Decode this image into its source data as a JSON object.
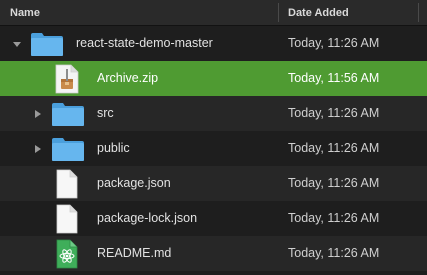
{
  "header": {
    "name_label": "Name",
    "date_label": "Date Added"
  },
  "rows": [
    {
      "name": "react-state-demo-master",
      "date": "Today, 11:26 AM",
      "icon": "folder-icon",
      "disclosure": "expanded"
    },
    {
      "name": "Archive.zip",
      "date": "Today, 11:56 AM",
      "icon": "zip-archive-icon",
      "selected": true
    },
    {
      "name": "src",
      "date": "Today, 11:26 AM",
      "icon": "folder-icon",
      "disclosure": "collapsed"
    },
    {
      "name": "public",
      "date": "Today, 11:26 AM",
      "icon": "folder-icon",
      "disclosure": "collapsed"
    },
    {
      "name": "package.json",
      "date": "Today, 11:26 AM",
      "icon": "document-icon"
    },
    {
      "name": "package-lock.json",
      "date": "Today, 11:26 AM",
      "icon": "document-icon"
    },
    {
      "name": "README.md",
      "date": "Today, 11:26 AM",
      "icon": "atom-document-icon"
    }
  ],
  "colors": {
    "selection": "#4f9b32",
    "folder": "#5fb0e8",
    "background": "#1e1e1e"
  }
}
